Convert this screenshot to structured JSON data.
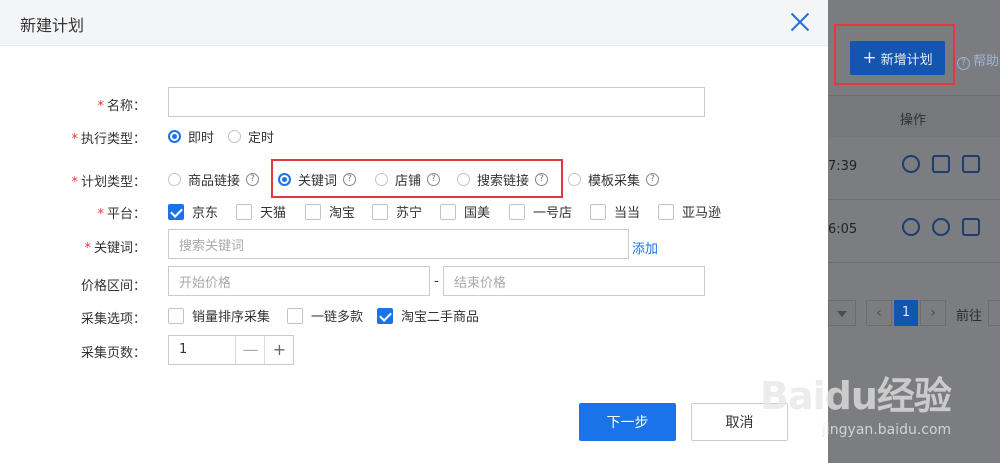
{
  "background": {
    "new_plan_button": "新增计划",
    "help_link": "帮助",
    "table_header_ops": "操作",
    "rows": [
      {
        "time": "7:39"
      },
      {
        "time": "6:05"
      }
    ],
    "pager": {
      "current_page": "1",
      "goto_label": "前往"
    }
  },
  "modal": {
    "title": "新建计划",
    "fields": {
      "name": {
        "label": "名称：",
        "value": ""
      },
      "exec_type": {
        "label": "执行类型：",
        "options": [
          "即时",
          "定时"
        ],
        "selected": "即时"
      },
      "plan_type": {
        "label": "计划类型：",
        "options": [
          "商品链接",
          "关键词",
          "店铺",
          "搜索链接",
          "模板采集"
        ],
        "selected": "关键词"
      },
      "platform": {
        "label": "平台：",
        "options": [
          "京东",
          "天猫",
          "淘宝",
          "苏宁",
          "国美",
          "一号店",
          "当当",
          "亚马逊"
        ],
        "checked": [
          "京东"
        ]
      },
      "keyword": {
        "label": "关键词：",
        "placeholder": "搜索关键词",
        "add_label": "添加"
      },
      "price_range": {
        "label": "价格区间：",
        "start_placeholder": "开始价格",
        "end_placeholder": "结束价格",
        "separator": "-"
      },
      "collect_options": {
        "label": "采集选项：",
        "options": [
          "销量排序采集",
          "一链多款",
          "淘宝二手商品"
        ],
        "checked": [
          "淘宝二手商品"
        ]
      },
      "pages": {
        "label": "采集页数：",
        "value": "1",
        "minus": "—",
        "plus": "+"
      }
    },
    "buttons": {
      "next": "下一步",
      "cancel": "取消"
    }
  },
  "watermark": {
    "main": "Baidu经验",
    "sub": "jingyan.baidu.com"
  },
  "colors": {
    "primary": "#1a73e8",
    "highlight": "#e4393c",
    "required": "#e4393c"
  }
}
